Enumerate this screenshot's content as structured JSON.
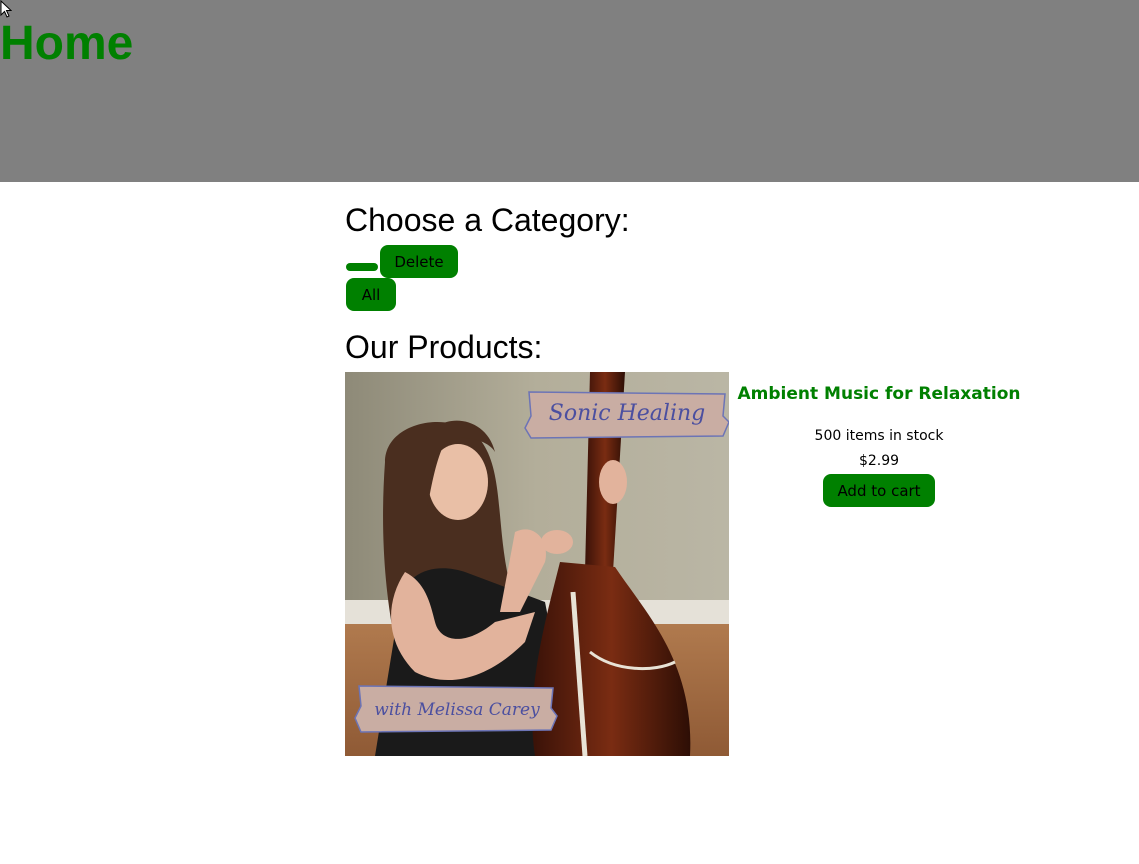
{
  "header": {
    "title": "Home",
    "background": "#808080",
    "title_color": "#008000"
  },
  "categories": {
    "title": "Choose a Category:",
    "empty_button_label": "",
    "delete_label": "Delete",
    "all_label": "All"
  },
  "products": {
    "title": "Our Products:",
    "items": [
      {
        "image_banner_top": "Sonic Healing",
        "image_banner_bottom": "with Melissa Carey",
        "name": "Ambient Music for Relaxation",
        "stock": "500 items in stock",
        "price": "$2.99",
        "cart_label": "Add to cart"
      }
    ]
  },
  "colors": {
    "accent": "#008000",
    "banner_fill": "#c9ada3",
    "banner_text": "#4b4fa0"
  }
}
